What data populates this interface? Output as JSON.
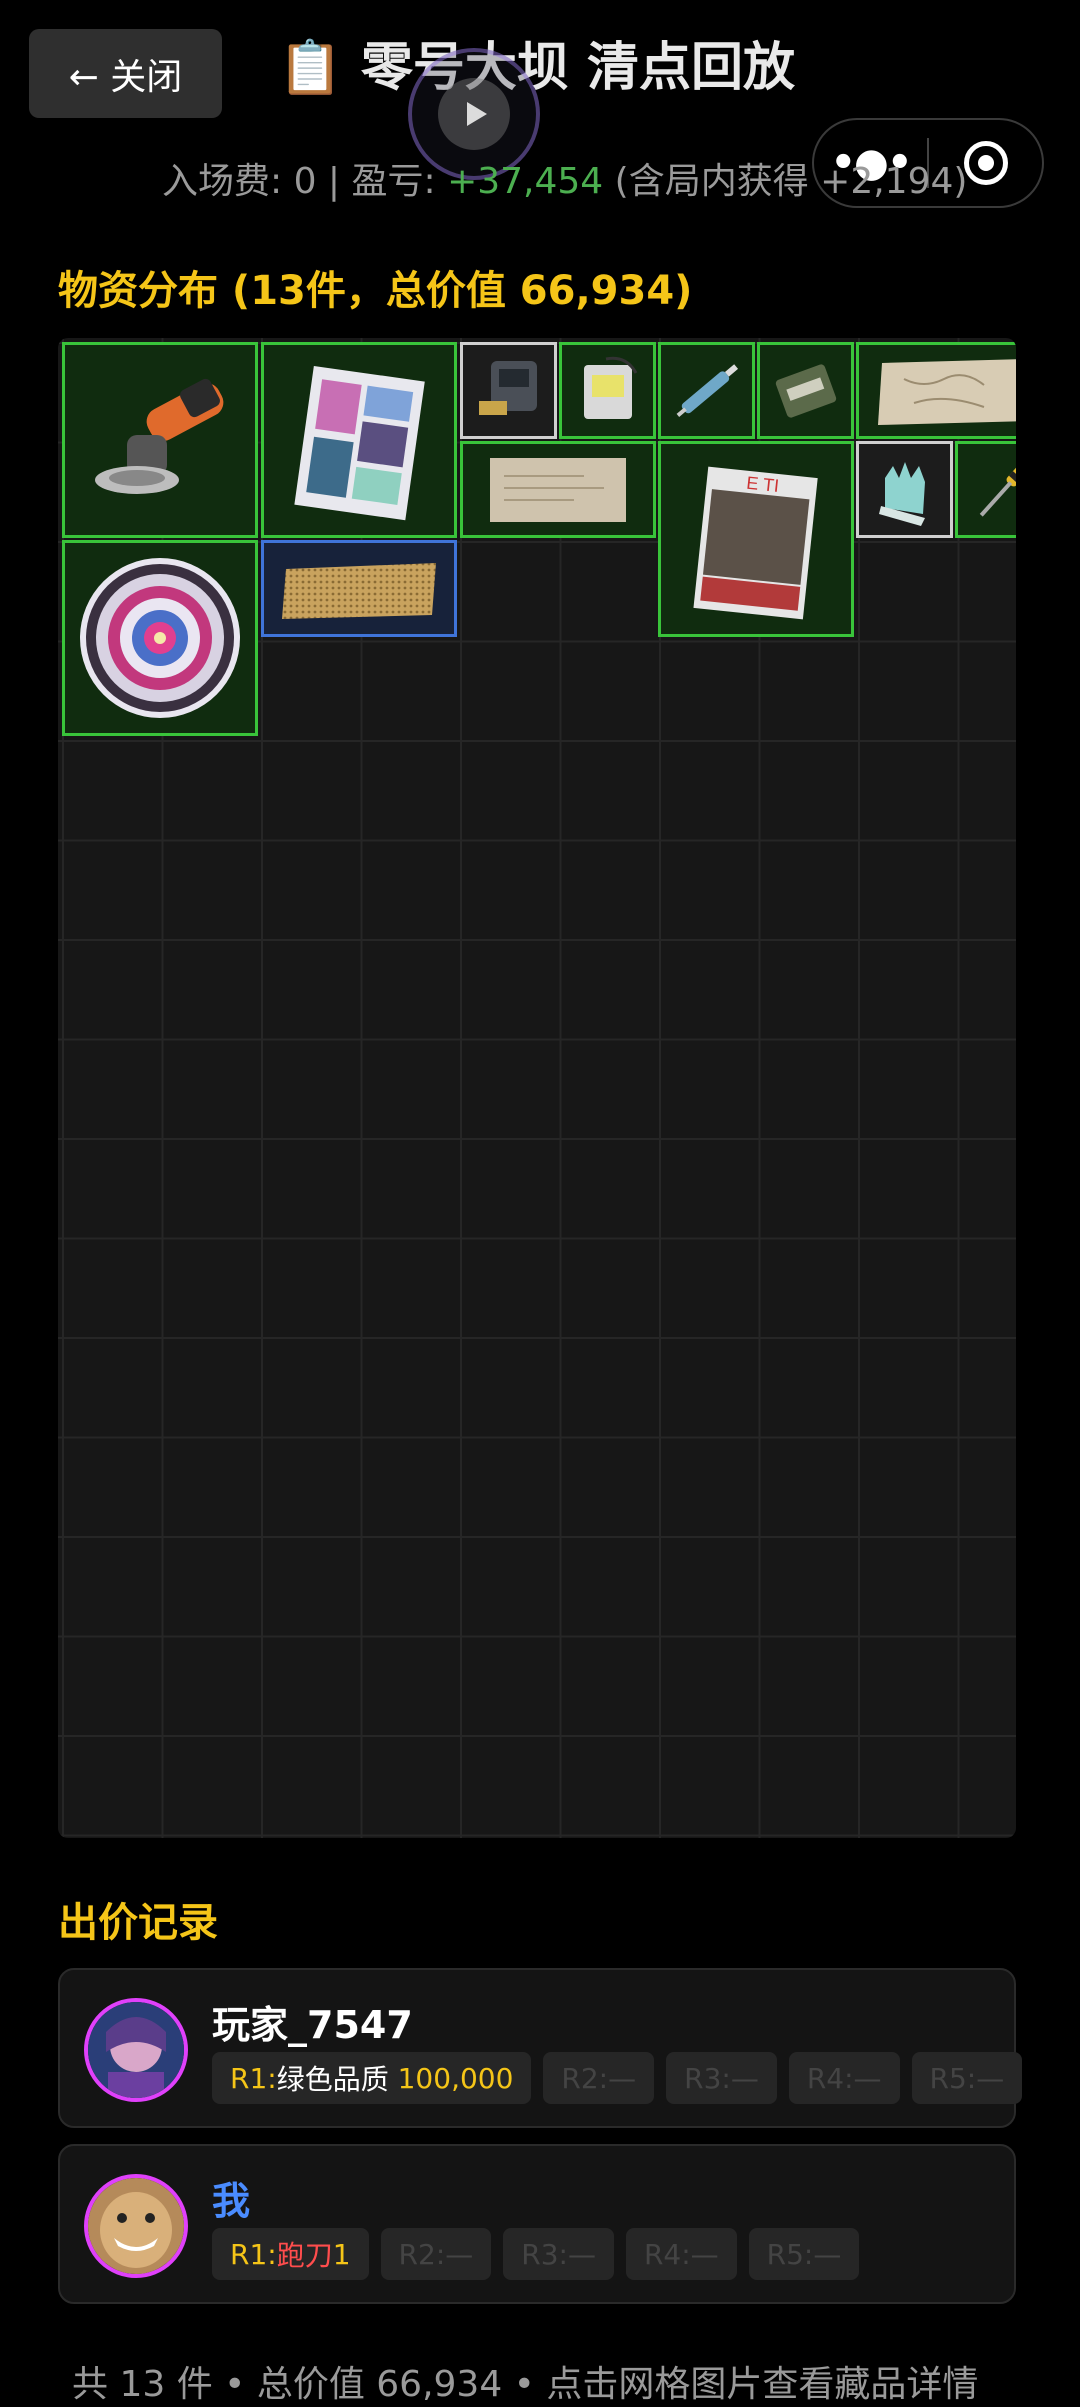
{
  "header": {
    "close_label": "← 关闭",
    "title": "📋 零号大坝 清点回放"
  },
  "summary": {
    "prefix": "入场费: 0 | 盈亏: ",
    "profit": "+37,454",
    "suffix": " (含局内获得 +2,194)"
  },
  "inventory": {
    "title": "物资分布 (13件，总价值 66,934)",
    "items": [
      {
        "name": "angle-grinder",
        "quality": "green"
      },
      {
        "name": "magazine",
        "quality": "green"
      },
      {
        "name": "electronic-device",
        "quality": "white"
      },
      {
        "name": "tablet-device",
        "quality": "green"
      },
      {
        "name": "syringe",
        "quality": "green"
      },
      {
        "name": "ration-pack",
        "quality": "green"
      },
      {
        "name": "old-map",
        "quality": "green"
      },
      {
        "name": "parchment",
        "quality": "green"
      },
      {
        "name": "war-magazine",
        "quality": "green"
      },
      {
        "name": "gloves",
        "quality": "white"
      },
      {
        "name": "screwdriver",
        "quality": "green"
      },
      {
        "name": "decorative-plate",
        "quality": "green"
      },
      {
        "name": "honeycomb-panel",
        "quality": "blue"
      }
    ]
  },
  "bids": {
    "title": "出价记录",
    "records": [
      {
        "player": "玩家_7547",
        "r1_prefix": "R1:",
        "r1_value": "绿色品质 100,000",
        "r2": "R2:—",
        "r3": "R3:—",
        "r4": "R4:—",
        "r5": "R5:—"
      },
      {
        "player": "我",
        "r1_prefix": "R1:",
        "r1_value_red": "跑刀",
        "r1_value": " 1",
        "r2": "R2:—",
        "r3": "R3:—",
        "r4": "R4:—",
        "r5": "R5:—"
      }
    ]
  },
  "footer": {
    "text": "共 13 件 • 总价值 66,934 • 点击网格图片查看藏品详情"
  },
  "colors": {
    "accent": "#f5c518",
    "profit": "#4caf50",
    "green_border": "#39c43a",
    "blue_border": "#3f74d9",
    "me_name": "#4a8cff",
    "red_text": "#ff4d4d"
  }
}
